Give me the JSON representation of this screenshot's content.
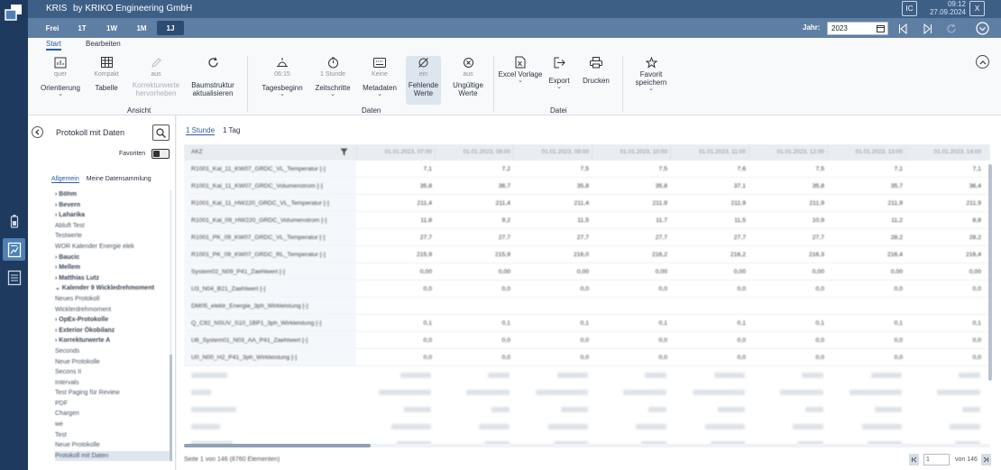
{
  "app": {
    "title": "KRIS",
    "subtitle": "by KRIKO Engineering GmbH",
    "user": "IC",
    "close": "X",
    "time": "09:12",
    "date": "27.09.2024"
  },
  "timebar": {
    "buttons": [
      "Frei",
      "1T",
      "1W",
      "1M",
      "1J"
    ],
    "selected": "1J",
    "year_label": "Jahr:",
    "year_value": "2023"
  },
  "ribbon": {
    "tabs": [
      "Start",
      "Bearbeiten"
    ],
    "buttons": [
      {
        "sub": "quer",
        "label": "Orientierung",
        "chev": "⌄"
      },
      {
        "sub": "Kompakt",
        "label": "Tabelle",
        "chev": ""
      },
      {
        "sub": "aus",
        "label": "Korrekturwerte hervorheben",
        "chev": ""
      },
      {
        "sub": "",
        "label": "Baumstruktur aktualisieren",
        "chev": ""
      },
      {
        "sub": "06:15",
        "label": "Tagesbeginn",
        "chev": "⌄"
      },
      {
        "sub": "1 Stunde",
        "label": "Zeitschritte",
        "chev": "⌄"
      },
      {
        "sub": "Keine",
        "label": "Metadaten",
        "chev": "⌄"
      },
      {
        "sub": "ein",
        "label": "Fehlende Werte",
        "chev": ""
      },
      {
        "sub": "aus",
        "label": "Ungültige Werte",
        "chev": ""
      },
      {
        "sub": "",
        "label": "Excel Vorlage",
        "chev": "⌄"
      },
      {
        "sub": "",
        "label": "Export",
        "chev": "⌄"
      },
      {
        "sub": "",
        "label": "Drucken",
        "chev": ""
      },
      {
        "sub": "",
        "label": "Favorit speichern",
        "chev": "⌄"
      }
    ],
    "groups": [
      "Ansicht",
      "Daten",
      "Datei"
    ]
  },
  "left": {
    "title": "Protokoll mit Daten",
    "favorites_label": "Favoriten",
    "tabs": [
      "Allgemein",
      "Meine Datensammlung"
    ],
    "tree": [
      {
        "t": "› Böhm",
        "b": true
      },
      {
        "t": "› Bevern",
        "b": true
      },
      {
        "t": "› Laharika",
        "b": true
      },
      {
        "t": "   Abluft Test",
        "b": false
      },
      {
        "t": "   Testwerte",
        "b": false
      },
      {
        "t": "   WOR Kalender Energie elek",
        "b": false
      },
      {
        "t": "› Baucic",
        "b": true
      },
      {
        "t": "› Mellem",
        "b": true
      },
      {
        "t": "› Matthias Lutz",
        "b": true
      },
      {
        "t": "⌄ Kalender 9 Wickledrehmoment",
        "b": true
      },
      {
        "t": "   Neues Protokoll",
        "b": false
      },
      {
        "t": "   Wicklerdrehmoment",
        "b": false
      },
      {
        "t": "› OpEx-Protokolle",
        "b": true
      },
      {
        "t": "› Exterior Ökobilanz",
        "b": true
      },
      {
        "t": "› Korrekturwerte A",
        "b": true
      },
      {
        "t": "Seconds",
        "b": false
      },
      {
        "t": "Neue Protokolle",
        "b": false
      },
      {
        "t": "Secons II",
        "b": false
      },
      {
        "t": "Intervals",
        "b": false
      },
      {
        "t": "Test Paging für Review",
        "b": false
      },
      {
        "t": "PDF",
        "b": false
      },
      {
        "t": "Chargen",
        "b": false
      },
      {
        "t": "we",
        "b": false
      },
      {
        "t": "Test",
        "b": false
      },
      {
        "t": "Neue Protokolle",
        "b": false
      },
      {
        "t": "Protokoll mit Daten",
        "b": false,
        "sel": true
      }
    ]
  },
  "main": {
    "tabs": [
      "1 Stunde",
      "1 Tag"
    ],
    "akz_header": "AKZ",
    "columns": [
      "01.01.2023, 07:00",
      "01.01.2023, 08:00",
      "01.01.2023, 09:00",
      "01.01.2023, 10:00",
      "01.01.2023, 11:00",
      "01.01.2023, 12:00",
      "01.01.2023, 13:00",
      "01.01.2023, 14:00"
    ],
    "rows": [
      {
        "name": "R1001_Kal_11_KW07_GRDC_VL_Temperatur [-]",
        "values": [
          "7,1",
          "7,2",
          "7,5",
          "7,5",
          "7,6",
          "7,5",
          "7,1",
          "7,1"
        ]
      },
      {
        "name": "R1001_Kal_11_KW07_GRDC_Volumenstrom [-]",
        "values": [
          "35,8",
          "36,7",
          "35,8",
          "35,8",
          "37,1",
          "35,8",
          "35,7",
          "36,4"
        ]
      },
      {
        "name": "R1001_Kal_11_HW220_GRDC_VL_Temperatur [-]",
        "values": [
          "211,4",
          "211,4",
          "211,4",
          "211,9",
          "211,9",
          "211,9",
          "211,9",
          "211,9"
        ]
      },
      {
        "name": "R1001_Kal_09_HW220_GRDC_Volumenstrom [-]",
        "values": [
          "11,8",
          "9,2",
          "11,5",
          "11,7",
          "11,5",
          "10,9",
          "11,2",
          "8,8"
        ]
      },
      {
        "name": "R1001_PK_09_KW07_GRDC_VL_Temperatur [-]",
        "values": [
          "27,7",
          "27,7",
          "27,7",
          "27,7",
          "27,7",
          "27,7",
          "28,2",
          "28,2"
        ]
      },
      {
        "name": "R1001_PK_09_KW07_GRDC_RL_Temperatur [-]",
        "values": [
          "215,9",
          "215,9",
          "216,0",
          "216,2",
          "216,2",
          "216,3",
          "216,4",
          "216,4"
        ]
      },
      {
        "name": "System02_N09_P41_Zaehlwert [-]",
        "values": [
          "0,00",
          "0,00",
          "0,00",
          "0,00",
          "0,00",
          "0,00",
          "0,00",
          "0,00"
        ]
      },
      {
        "name": "U3_N04_B21_Zaehlwert [-]",
        "values": [
          "0,0",
          "0,0",
          "0,0",
          "0,0",
          "0,0",
          "0,0",
          "0,0",
          "0,0"
        ]
      },
      {
        "name": "DM05_elektr_Energie_3ph_Wirkleistung [-]",
        "values": [
          "",
          "",
          "",
          "",
          "",
          "",
          "",
          ""
        ]
      },
      {
        "name": "Q_C92_NSUV_S10_1BP1_3ph_Wirkleistung [-]",
        "values": [
          "0,1",
          "0,1",
          "0,1",
          "0,1",
          "0,1",
          "0,1",
          "0,1",
          "0,1"
        ]
      },
      {
        "name": "U6_System01_N03_AA_P41_Zaehlwert [-]",
        "values": [
          "0,0",
          "0,0",
          "0,0",
          "0,0",
          "0,0",
          "0,0",
          "0,0",
          "0,0"
        ]
      },
      {
        "name": "U0_N00_H2_P41_3ph_Wirkleistung [-]",
        "values": [
          "0,0",
          "0,0",
          "0,0",
          "0,0",
          "0,0",
          "0,0",
          "0,0",
          "0,0"
        ]
      }
    ],
    "footer": "Seite 1 von 146 (8760 Elementen)",
    "page_value": "1",
    "page_of": "von 146"
  }
}
